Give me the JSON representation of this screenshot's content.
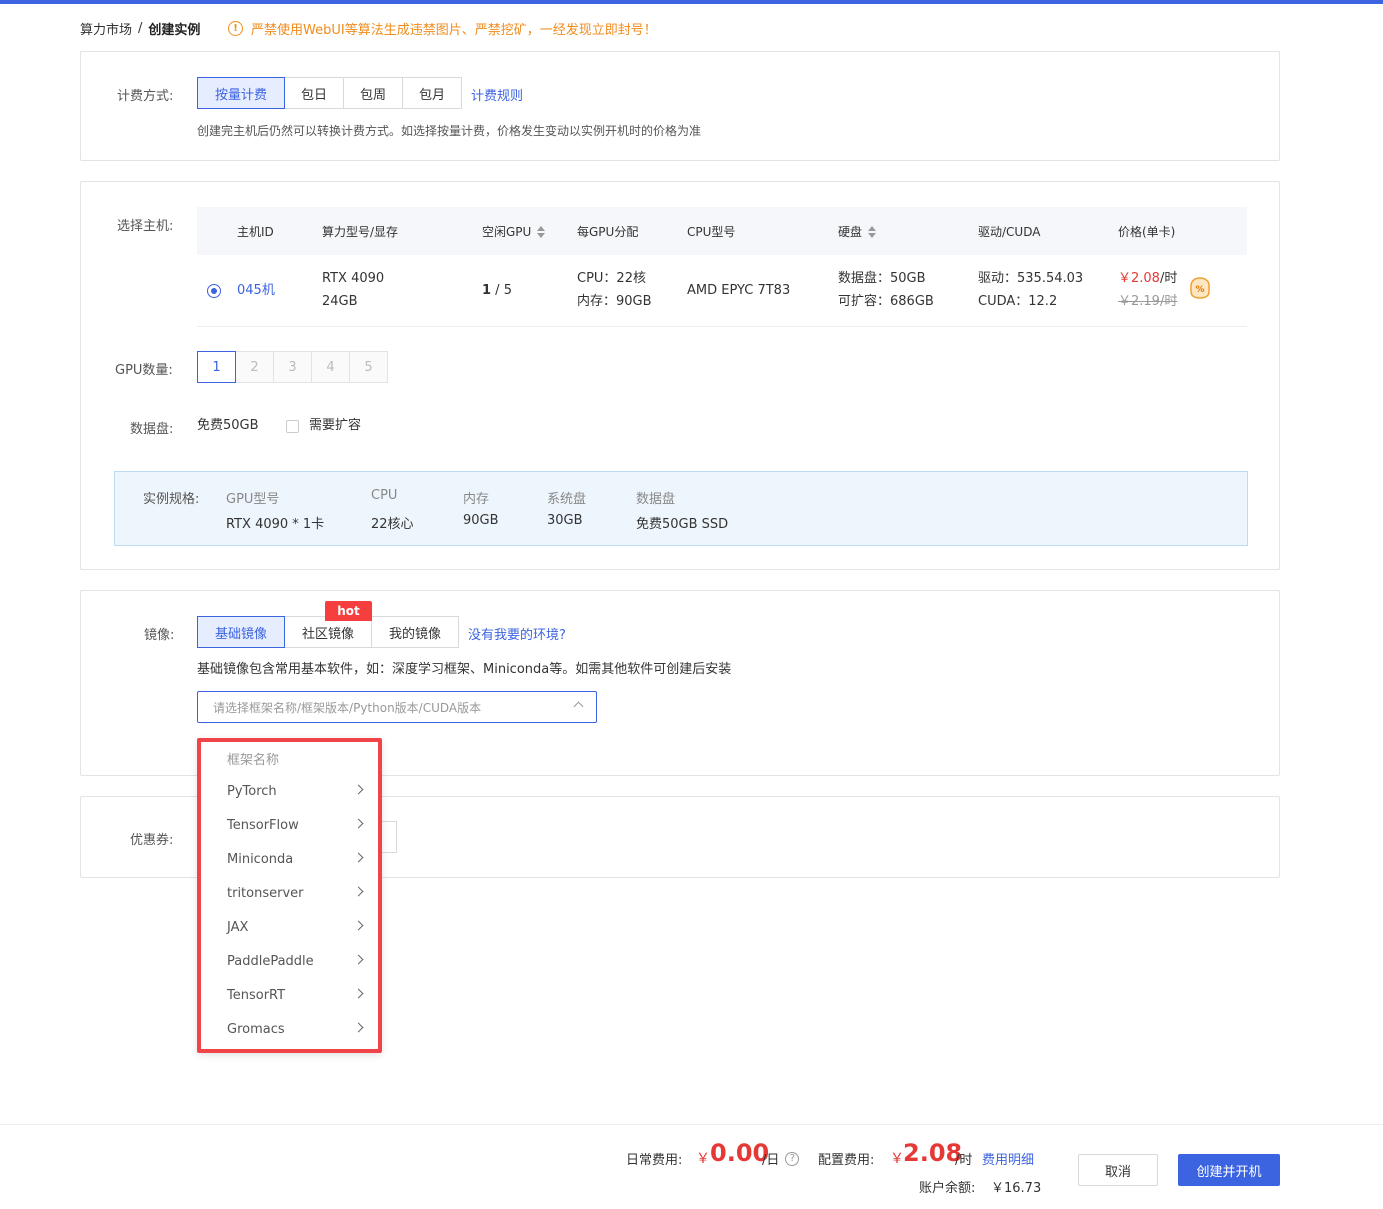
{
  "breadcrumb": {
    "parent": "算力市场",
    "separator": "/",
    "current": "创建实例"
  },
  "warning": {
    "icon": "exclamation-circle-icon",
    "text": "严禁使用WebUI等算法生成违禁图片、严禁挖矿，一经发现立即封号！"
  },
  "billing": {
    "label": "计费方式:",
    "options": [
      "按量计费",
      "包日",
      "包周",
      "包月"
    ],
    "selected": "按量计费",
    "rules_link": "计费规则",
    "hint": "创建完主机后仍然可以转换计费方式。如选择按量计费，价格发生变动以实例开机时的价格为准"
  },
  "host": {
    "label": "选择主机:",
    "columns": [
      "主机ID",
      "算力型号/显存",
      "空闲GPU",
      "每GPU分配",
      "CPU型号",
      "硬盘",
      "驱动/CUDA",
      "价格(单卡)"
    ],
    "row": {
      "id": "045机",
      "gpu_model": "RTX 4090",
      "vram": "24GB",
      "free_gpu": "1",
      "total_gpu": " / 5",
      "cpu_alloc": "CPU：22核",
      "mem_alloc": "内存：90GB",
      "cpu_model": "AMD EPYC 7T83",
      "data_disk": "数据盘：50GB",
      "expandable": "可扩容：686GB",
      "driver": "驱动：535.54.03",
      "cuda": "CUDA：12.2",
      "price_now": "￥2.08",
      "price_now_unit": "/时",
      "price_old": "￥2.19/时"
    }
  },
  "gpu_count": {
    "label": "GPU数量:",
    "options": [
      "1",
      "2",
      "3",
      "4",
      "5"
    ],
    "selected": "1"
  },
  "data_disk": {
    "label": "数据盘:",
    "free": "免费50GB",
    "expand_label": "需要扩容"
  },
  "spec": {
    "label": "实例规格:",
    "items": [
      {
        "k": "GPU型号",
        "v": "RTX 4090 * 1卡"
      },
      {
        "k": "CPU",
        "v": "22核心"
      },
      {
        "k": "内存",
        "v": "90GB"
      },
      {
        "k": "系统盘",
        "v": "30GB"
      },
      {
        "k": "数据盘",
        "v": "免费50GB SSD"
      }
    ]
  },
  "image": {
    "label": "镜像:",
    "tabs": [
      "基础镜像",
      "社区镜像",
      "我的镜像"
    ],
    "selected": "基础镜像",
    "hot_badge": "hot",
    "missing_link": "没有我要的环境?",
    "hint": "基础镜像包含常用基本软件，如：深度学习框架、Miniconda等。如需其他软件可创建后安装",
    "placeholder": "请选择框架名称/框架版本/Python版本/CUDA版本"
  },
  "coupon": {
    "label": "优惠券:"
  },
  "dropdown": {
    "header": "框架名称",
    "items": [
      "PyTorch",
      "TensorFlow",
      "Miniconda",
      "tritonserver",
      "JAX",
      "PaddlePaddle",
      "TensorRT",
      "Gromacs"
    ]
  },
  "footer": {
    "daily_label": "日常费用:",
    "daily_currency": "￥",
    "daily_amount": "0.00",
    "daily_unit": "/日",
    "config_label": "配置费用:",
    "config_currency": "￥",
    "config_amount": "2.08",
    "config_unit": "/时",
    "detail_link": "费用明细",
    "balance_label": "账户余额:",
    "balance_value": "￥16.73",
    "cancel": "取消",
    "create": "创建并开机"
  },
  "colors": {
    "primary": "#3c63e0",
    "warning": "#f08c1c",
    "price": "#e53935",
    "highlight_border": "#f0434a"
  }
}
